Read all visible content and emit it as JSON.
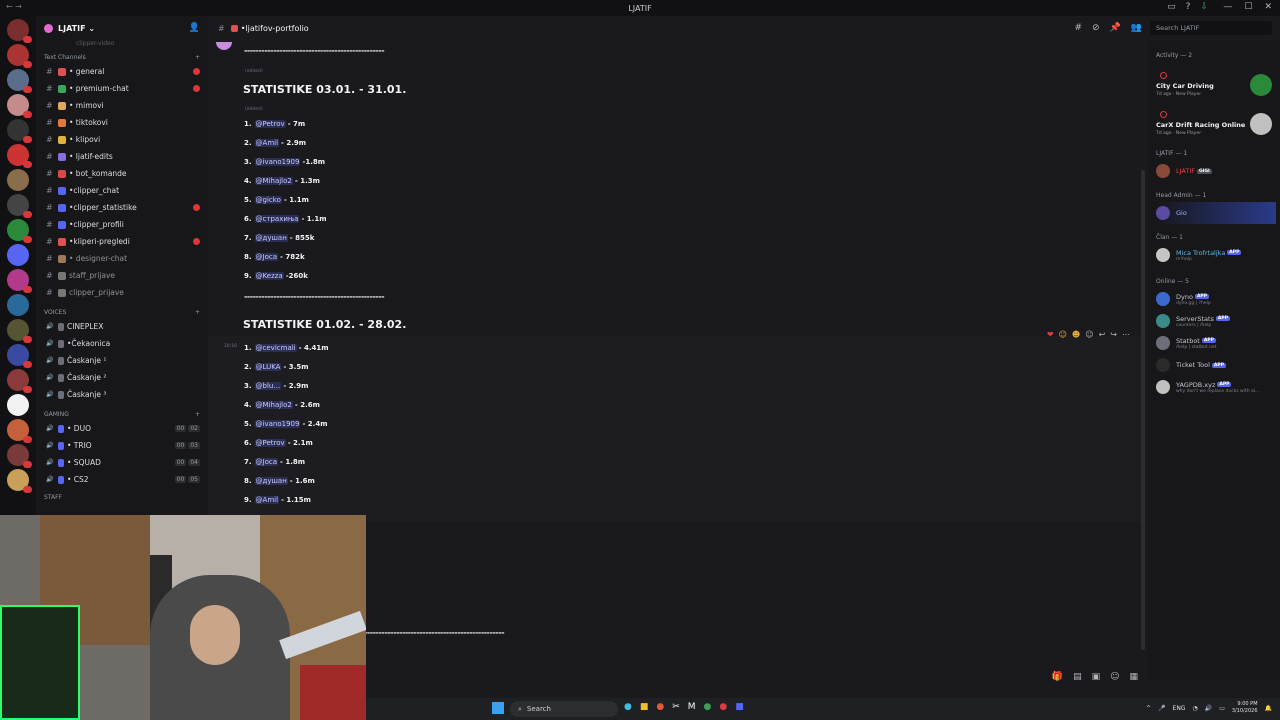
{
  "window": {
    "title": "LJATIF"
  },
  "server": {
    "name": "LJATIF ⌄"
  },
  "sidebar": {
    "clipped_top": "clipper-video",
    "text_category": "Text Channels",
    "text_channels": [
      {
        "label": "• general",
        "unread": true,
        "color": "#e05252"
      },
      {
        "label": "• premium-chat",
        "unread": true,
        "color": "#3ba55c"
      },
      {
        "label": "• mimovi",
        "unread": false,
        "color": "#e0a85a"
      },
      {
        "label": "• tiktokovi",
        "unread": false,
        "color": "#e07a3a"
      },
      {
        "label": "• klipovi",
        "unread": false,
        "color": "#e0b341"
      },
      {
        "label": "• ljatif-edits",
        "unread": false,
        "color": "#8a6de0"
      },
      {
        "label": "• bot_komande",
        "unread": false,
        "color": "#d84a4a"
      },
      {
        "label": "•clipper_chat",
        "unread": false,
        "color": "#5865f2"
      },
      {
        "label": "•clipper_statistike",
        "unread": true,
        "color": "#5865f2"
      },
      {
        "label": "•clipper_profili",
        "unread": false,
        "color": "#5865f2"
      },
      {
        "label": "•kliperi-pregledi",
        "unread": true,
        "color": "#e05252"
      },
      {
        "label": "• designer-chat",
        "unread": false,
        "color": "#a0785a",
        "dim": true
      },
      {
        "label": "staff_prijave",
        "unread": false,
        "color": "#777",
        "dim": true
      },
      {
        "label": "clipper_prijave",
        "unread": false,
        "color": "#777",
        "dim": true
      }
    ],
    "voice_category": "VOICES",
    "voice_channels": [
      {
        "label": "CINEPLEX"
      },
      {
        "label": "•Čekaonica"
      },
      {
        "label": "Časkanje ¹"
      },
      {
        "label": "Časkanje ²"
      },
      {
        "label": "Časkanje ³"
      }
    ],
    "gaming_category": "GAMING",
    "gaming_channels": [
      {
        "label": "• DUO",
        "a": "00",
        "b": "02"
      },
      {
        "label": "• TRIO",
        "a": "00",
        "b": "03"
      },
      {
        "label": "• SQUAD",
        "a": "00",
        "b": "04"
      },
      {
        "label": "• CS2",
        "a": "00",
        "b": "05"
      }
    ],
    "staff_category": "STAFF"
  },
  "header": {
    "channel": "•ljatifov-portfolio"
  },
  "search": {
    "placeholder": "Search LJATIF"
  },
  "chat": {
    "dashes": "------------------------------------------------",
    "edited": "(edited)",
    "block1": {
      "heading": "STATISTIKE 03.01. - 31.01.",
      "rows": [
        {
          "n": "1.",
          "user": "@Petrov",
          "val": "- 7m"
        },
        {
          "n": "2.",
          "user": "@Amil",
          "val": "- 2.9m"
        },
        {
          "n": "3.",
          "user": "@ivano1909",
          "val": "-1.8m"
        },
        {
          "n": "4.",
          "user": "@Mihajlo2",
          "val": "- 1.3m"
        },
        {
          "n": "5.",
          "user": "@gicko",
          "val": "- 1.1m"
        },
        {
          "n": "6.",
          "user": "@страхиња",
          "val": "- 1.1m"
        },
        {
          "n": "7.",
          "user": "@душан",
          "val": "- 855k"
        },
        {
          "n": "8.",
          "user": "@Joca",
          "val": "- 782k"
        },
        {
          "n": "9.",
          "user": "@Kezza",
          "val": "-260k"
        }
      ]
    },
    "block2": {
      "timestamp": "18:16",
      "heading": "STATISTIKE 01.02. - 28.02.",
      "rows": [
        {
          "n": "1.",
          "user": "@cevicmali",
          "val": "- 4.41m"
        },
        {
          "n": "2.",
          "user": "@LUKA",
          "val": "- 3.5m"
        },
        {
          "n": "3.",
          "user": "@blu…",
          "val": "- 2.9m"
        },
        {
          "n": "4.",
          "user": "@Mihajlo2",
          "val": "- 2.6m"
        },
        {
          "n": "5.",
          "user": "@ivano1909",
          "val": "- 2.4m"
        },
        {
          "n": "6.",
          "user": "@Petrov",
          "val": "- 2.1m"
        },
        {
          "n": "7.",
          "user": "@Joca",
          "val": "- 1.8m"
        },
        {
          "n": "8.",
          "user": "@душан",
          "val": "- 1.6m"
        },
        {
          "n": "9.",
          "user": "@Amil",
          "val": "- 1.15m"
        }
      ]
    }
  },
  "members": {
    "activity_label": "Activity — 2",
    "activities": [
      {
        "name": "City Car Driving",
        "sub": "7d ago · New Player"
      },
      {
        "name": "CarX Drift Racing Online",
        "sub": "7d ago · New Player"
      }
    ],
    "ljatif_label": "LJATIF — 1",
    "ljatif_member": {
      "name": "LJATIF",
      "tag": "GIGI"
    },
    "head_admin_label": "Head Admin — 1",
    "head_admin": {
      "name": "Gio"
    },
    "clan_label": "Član — 1",
    "clan_member": {
      "name": "Mica Trofrtaljka",
      "tag": "APP",
      "sub": "m!help"
    },
    "online_label": "Online — 5",
    "online": [
      {
        "name": "Dyno",
        "tag": "APP",
        "sub": "dyno.gg | ?help"
      },
      {
        "name": "ServerStats",
        "tag": "APP",
        "sub": "counters | /help"
      },
      {
        "name": "Statbot",
        "tag": "APP",
        "sub": "/help | statbot.net"
      },
      {
        "name": "Ticket Tool",
        "tag": "APP",
        "sub": ""
      },
      {
        "name": "YAGPDB.xyz",
        "tag": "APP",
        "sub": "why don't we replace ducks with ai..."
      }
    ]
  },
  "taskbar": {
    "search_label": "Search",
    "lang": "ENG",
    "time": "9:00 PM",
    "date": "3/10/2026"
  },
  "icons": {
    "search": "search-icon",
    "hash": "hash-icon",
    "speaker": "speaker-icon",
    "windows": "windows-icon"
  }
}
